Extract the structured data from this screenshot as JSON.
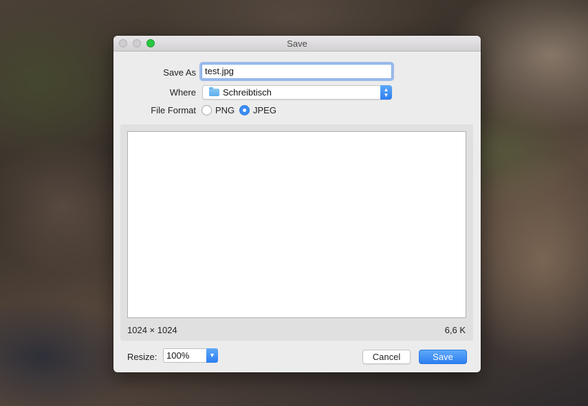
{
  "dialog": {
    "title": "Save",
    "save_as": {
      "label": "Save As",
      "value": "test.jpg"
    },
    "where": {
      "label": "Where",
      "value": "Schreibtisch",
      "icon": "folder-icon"
    },
    "file_format": {
      "label": "File Format",
      "options": [
        {
          "label": "PNG",
          "selected": false
        },
        {
          "label": "JPEG",
          "selected": true
        }
      ]
    },
    "preview": {
      "dimensions": "1024 × 1024",
      "file_size": "6,6 K"
    },
    "resize": {
      "label": "Resize:",
      "value": "100%"
    },
    "buttons": {
      "cancel": "Cancel",
      "save": "Save"
    }
  },
  "colors": {
    "accent": "#2c7ff1",
    "window_bg": "#ececec",
    "zoom_button": "#2ac840"
  }
}
